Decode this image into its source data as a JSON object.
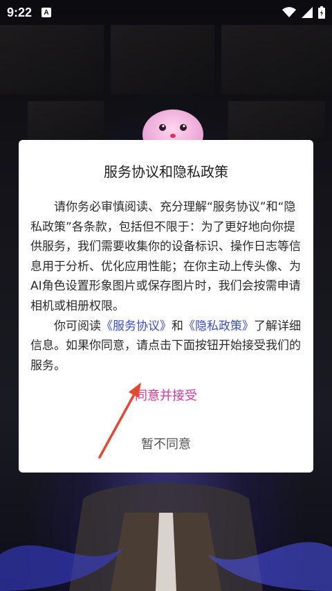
{
  "status_bar": {
    "time": "9:22",
    "notification_label": "A"
  },
  "dialog": {
    "title": "服务协议和隐私政策",
    "paragraph1": "请你务必审慎阅读、充分理解“服务协议”和“隐私政策”各条款，包括但不限于：为了更好地向你提供服务，我们需要收集你的设备标识、操作日志等信息用于分析、优化应用性能；在你主动上传头像、为AI角色设置形象图片或保存图片时，我们会按需申请相机或相册权限。",
    "p2_before": "你可阅读",
    "service_link": "《服务协议》",
    "p2_and": "和",
    "privacy_link": "《隐私政策》",
    "p2_after": "了解详细信息。如果你同意，请点击下面按钮开始接受我们的服务。",
    "agree_label": "同意并接受",
    "decline_label": "暂不同意"
  },
  "colors": {
    "agree": "#e0359a",
    "link": "#3a4bd8",
    "arrow": "#e8462e"
  },
  "icons": [
    "wifi-icon",
    "signal-icon",
    "battery-icon",
    "mascot-icon",
    "arrow-annotation-icon"
  ]
}
